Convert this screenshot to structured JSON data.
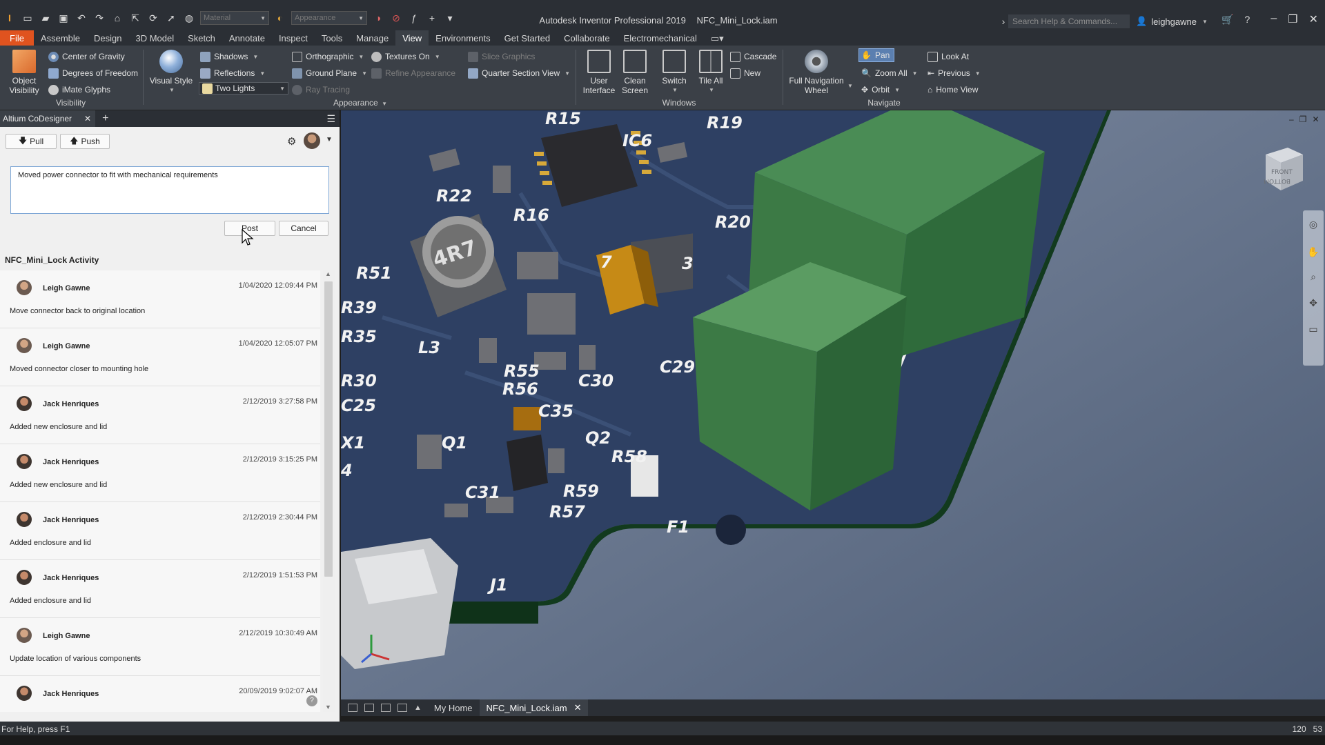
{
  "titlebar": {
    "quick_access_combo1": "Material",
    "quick_access_combo2": "Appearance",
    "app_name": "Autodesk Inventor Professional 2019",
    "document": "NFC_Mini_Lock.iam",
    "search_placeholder": "Search Help & Commands...",
    "username": "leighgawne"
  },
  "ribbon_tabs": [
    "File",
    "Assemble",
    "Design",
    "3D Model",
    "Sketch",
    "Annotate",
    "Inspect",
    "Tools",
    "Manage",
    "View",
    "Environments",
    "Get Started",
    "Collaborate",
    "Electromechanical"
  ],
  "ribbon": {
    "visibility": {
      "title": "Visibility",
      "object_visibility": "Object\nVisibility",
      "center_of_gravity": "Center of Gravity",
      "degrees_of_freedom": "Degrees of Freedom",
      "imate_glyphs": "iMate Glyphs"
    },
    "appearance": {
      "title": "Appearance",
      "visual_style": "Visual Style",
      "shadows": "Shadows",
      "reflections": "Reflections",
      "lighting": "Two Lights",
      "orthographic": "Orthographic",
      "ground_plane": "Ground Plane",
      "ray_tracing": "Ray Tracing",
      "textures_on": "Textures On",
      "refine_appearance": "Refine Appearance",
      "slice_graphics": "Slice Graphics",
      "quarter_section_view": "Quarter Section View"
    },
    "windows": {
      "title": "Windows",
      "user_interface": "User\nInterface",
      "clean_screen": "Clean\nScreen",
      "switch": "Switch",
      "tile_all": "Tile All",
      "cascade": "Cascade",
      "new": "New"
    },
    "navigate": {
      "title": "Navigate",
      "full_navigation_wheel": "Full Navigation\nWheel",
      "pan": "Pan",
      "zoom_all": "Zoom All",
      "orbit": "Orbit",
      "look_at": "Look At",
      "previous": "Previous",
      "home_view": "Home View"
    }
  },
  "panel": {
    "tab_label": "Altium CoDesigner",
    "pull_label": "Pull",
    "push_label": "Push",
    "comment_text": "Moved power connector to fit with mechanical requirements",
    "post_label": "Post",
    "cancel_label": "Cancel",
    "activity_title": "NFC_Mini_Lock Activity",
    "activity": [
      {
        "name": "Leigh Gawne",
        "date": "1/04/2020 12:09:44 PM",
        "text": "Move connector back to original location"
      },
      {
        "name": "Leigh Gawne",
        "date": "1/04/2020 12:05:07 PM",
        "text": "Moved connector closer to mounting hole"
      },
      {
        "name": "Jack Henriques",
        "date": "2/12/2019 3:27:58 PM",
        "text": "Added new enclosure and lid"
      },
      {
        "name": "Jack Henriques",
        "date": "2/12/2019 3:15:25 PM",
        "text": "Added new enclosure and lid"
      },
      {
        "name": "Jack Henriques",
        "date": "2/12/2019 2:30:44 PM",
        "text": "Added enclosure and lid"
      },
      {
        "name": "Jack Henriques",
        "date": "2/12/2019 1:51:53 PM",
        "text": "Added enclosure and lid"
      },
      {
        "name": "Leigh Gawne",
        "date": "2/12/2019 10:30:49 AM",
        "text": "Update location of various components"
      },
      {
        "name": "Jack Henriques",
        "date": "20/09/2019 9:02:07 AM",
        "text": ""
      }
    ]
  },
  "viewport": {
    "viewcube_front": "FRONT",
    "viewcube_bottom": "BOTTOM",
    "pcb_labels": [
      "R15",
      "R19",
      "IC6",
      "R22",
      "R16",
      "R20",
      "R51",
      "R39",
      "R35",
      "L3",
      "R55",
      "R56",
      "C30",
      "C29",
      "R30",
      "C25",
      "C35",
      "X1",
      "Q1",
      "Q2",
      "R58",
      "4",
      "R59",
      "R57",
      "C31",
      "F1",
      "J1"
    ],
    "inductor_marking": "4R7",
    "digit_label_1": "7",
    "digit_label_2": "3"
  },
  "doc_tabs": {
    "home": "My Home",
    "document": "NFC_Mini_Lock.iam"
  },
  "status": {
    "help": "For Help, press F1",
    "count_a": "120",
    "count_b": "53"
  },
  "colors": {
    "file_tab": "#e0531f",
    "ribbon_bg": "#3b4047",
    "pcb_board": "#2e4063",
    "gold_pad": "#d7a93a",
    "connector_green": "#3c7a45"
  }
}
